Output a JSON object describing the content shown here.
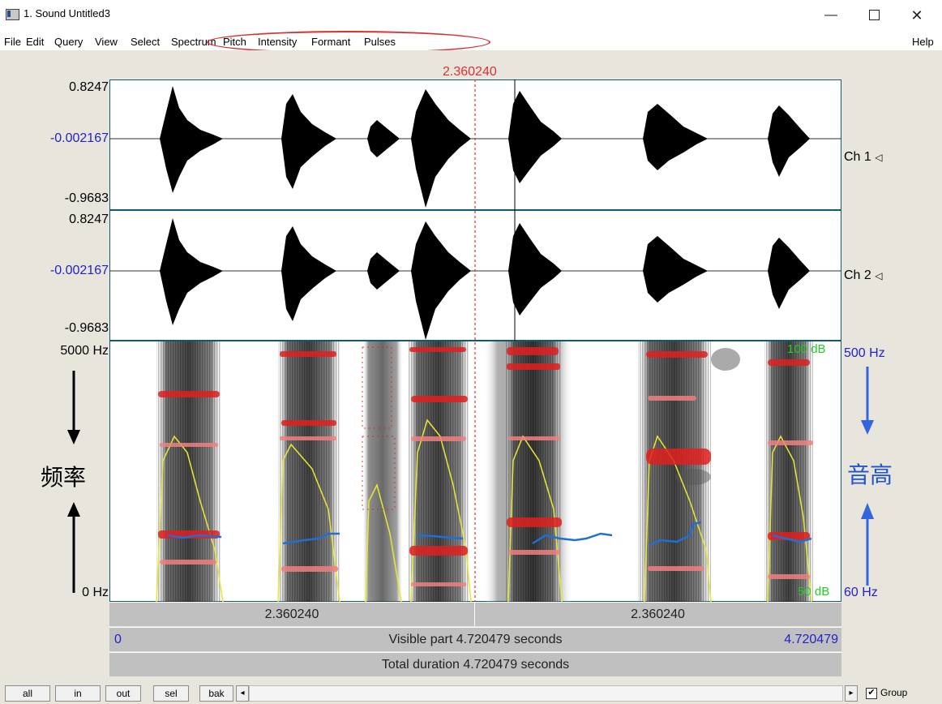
{
  "window": {
    "title": "1. Sound Untitled3",
    "minimize": "—",
    "close": "✕"
  },
  "menubar": {
    "items": [
      "File",
      "Edit",
      "Query",
      "View",
      "Select",
      "Spectrum",
      "Pitch",
      "Intensity",
      "Formant",
      "Pulses"
    ],
    "help": "Help"
  },
  "cursor": {
    "time_label": "2.360240"
  },
  "channels": [
    {
      "max": "0.8247",
      "mid": "-0.002167",
      "min": "-0.9683",
      "name": "Ch 1"
    },
    {
      "max": "0.8247",
      "mid": "-0.002167",
      "min": "-0.9683",
      "name": "Ch 2"
    }
  ],
  "spectrogram": {
    "freq_top": "5000 Hz",
    "freq_bottom": "0 Hz",
    "intensity_top": "100 dB",
    "intensity_bottom": "50 dB",
    "pitch_top": "500 Hz",
    "pitch_bottom": "60 Hz",
    "left_annotation": "频率",
    "right_annotation": "音高"
  },
  "bars": {
    "left_segment": "2.360240",
    "right_segment": "2.360240",
    "visible_start": "0",
    "visible_label": "Visible part 4.720479 seconds",
    "visible_end": "4.720479",
    "total_label": "Total duration 4.720479 seconds"
  },
  "toolbar": {
    "all": "all",
    "in": "in",
    "out": "out",
    "sel": "sel",
    "bak": "bak",
    "scroll_left": "◂",
    "scroll_right": "▸",
    "group_label": "Group",
    "group_checked": true
  },
  "colors": {
    "cursor": "#e03030",
    "axis_blue": "#2222cc",
    "pitch": "#1f6fd6",
    "formant": "#e02020",
    "intensity": "#e8e830",
    "db": "#22cc22"
  }
}
